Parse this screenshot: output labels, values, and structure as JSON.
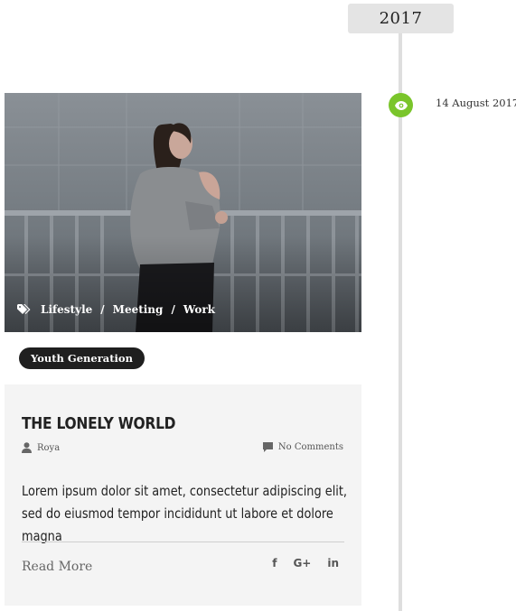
{
  "timeline": {
    "year": "2017",
    "date": "14 August 2017"
  },
  "post": {
    "tags": [
      "Lifestyle",
      "Meeting",
      "Work"
    ],
    "tag_separator": "/",
    "category": "Youth Generation",
    "title": "THE LONELY WORLD",
    "author": "Roya",
    "comments": "No Comments",
    "excerpt": "Lorem ipsum dolor sit amet, consectetur adipiscing elit, sed do eiusmod tempor incididunt ut labore et dolore magna",
    "read_more": "Read More",
    "social": {
      "facebook": "f",
      "google_plus": "G+",
      "linkedin": "in"
    }
  },
  "colors": {
    "accent": "#7ac52b",
    "badge_bg": "#e4e4e4",
    "card_bg": "#f4f4f4",
    "pill_bg": "#1f1f1f"
  }
}
